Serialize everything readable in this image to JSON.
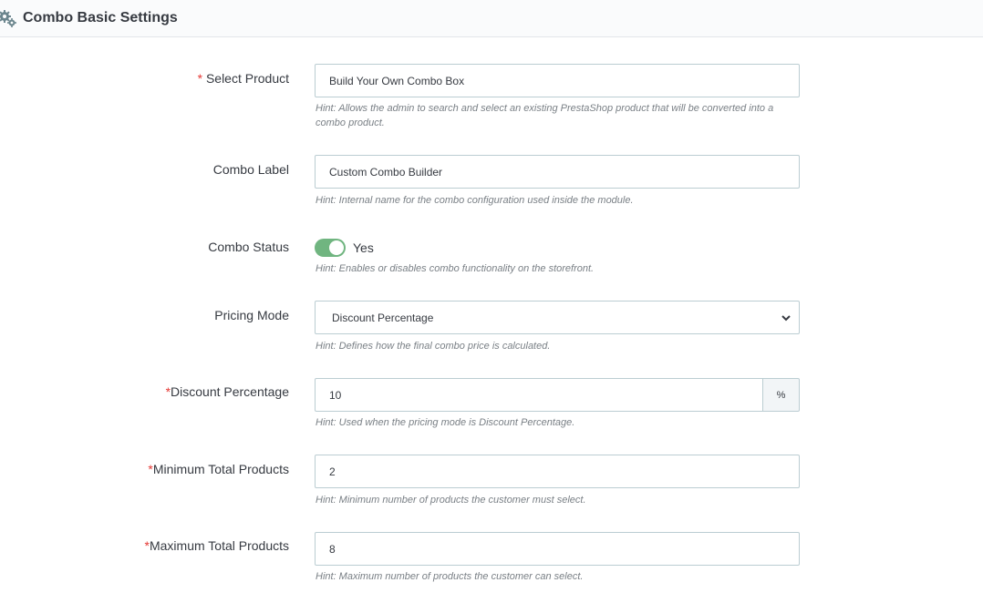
{
  "header": {
    "title": "Combo Basic Settings",
    "icon": "gears-icon"
  },
  "fields": {
    "select_product": {
      "required_mark": "*",
      "label": " Select Product",
      "value": "Build Your Own Combo Box",
      "hint": "Hint: Allows the admin to search and select an existing PrestaShop product that will be converted into a combo product."
    },
    "combo_label": {
      "label": "Combo Label",
      "value": "Custom Combo Builder",
      "hint": "Hint: Internal name for the combo configuration used inside the module."
    },
    "combo_status": {
      "label": "Combo Status",
      "state": "Yes",
      "enabled": true,
      "toggle_color": "#70b580",
      "hint": "Hint: Enables or disables combo functionality on the storefront."
    },
    "pricing_mode": {
      "label": "Pricing Mode",
      "selected": "Discount Percentage",
      "hint": "Hint: Defines how the final combo price is calculated."
    },
    "discount_percentage": {
      "required_mark": "*",
      "label": "Discount Percentage",
      "value": "10",
      "addon": "%",
      "hint": "Hint: Used when the pricing mode is Discount Percentage."
    },
    "minimum_total_products": {
      "required_mark": "*",
      "label": "Minimum Total Products",
      "value": "2",
      "hint": "Hint: Minimum number of products the customer must select."
    },
    "maximum_total_products": {
      "required_mark": "*",
      "label": "Maximum Total Products",
      "value": "8",
      "hint": "Hint: Maximum number of products the customer can select."
    }
  }
}
